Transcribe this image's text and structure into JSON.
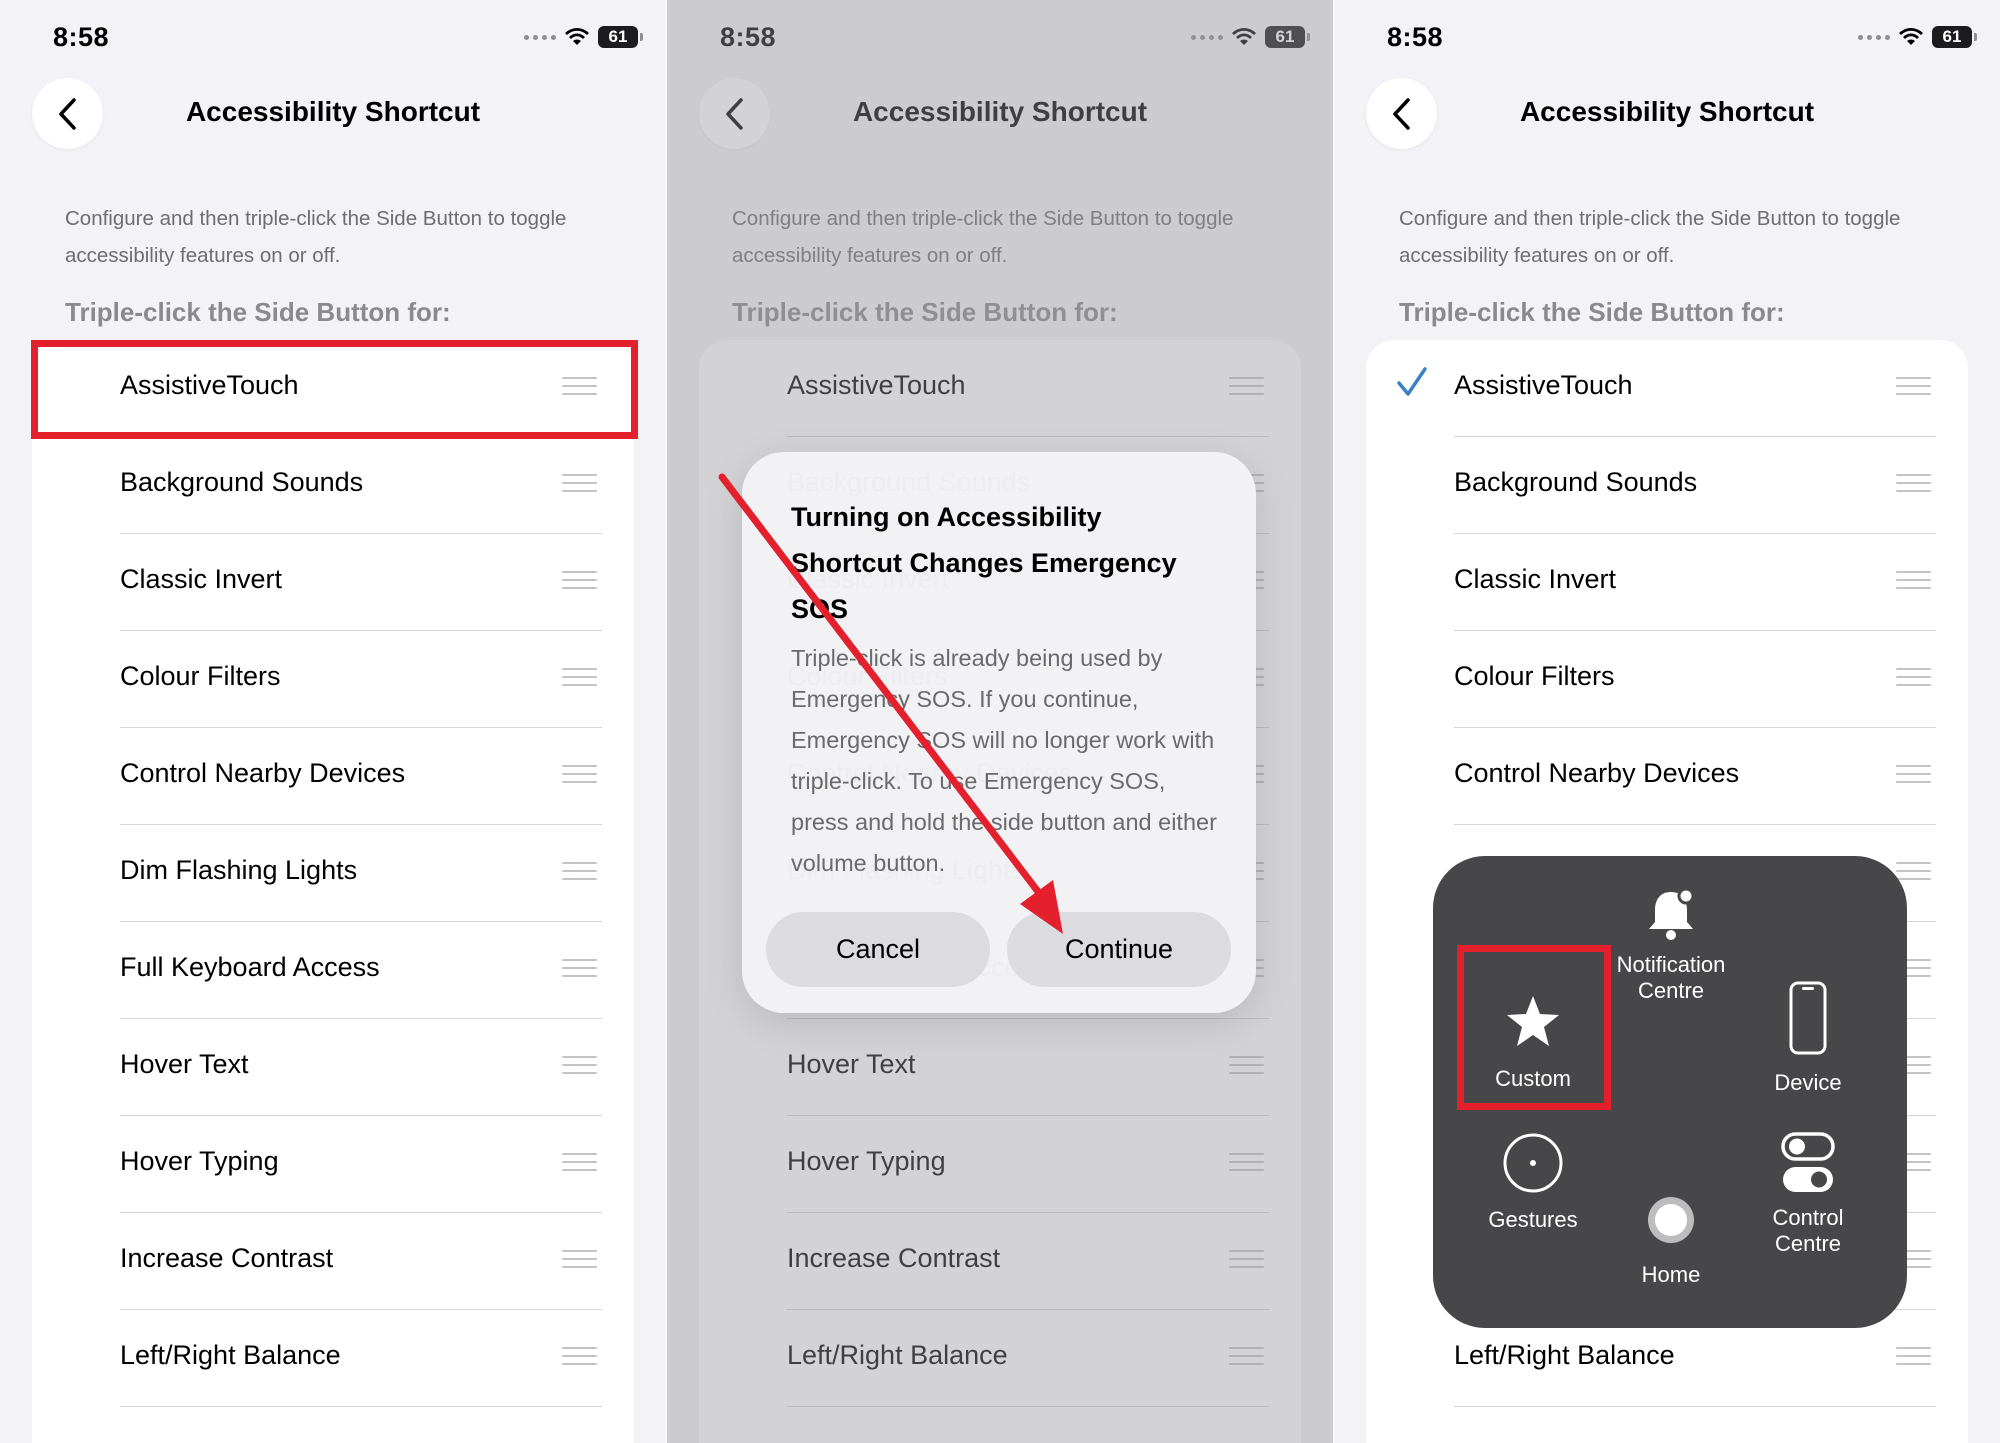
{
  "status": {
    "time": "8:58",
    "battery": "61"
  },
  "header": {
    "title": "Accessibility Shortcut"
  },
  "description": "Configure and then triple-click the Side Button to toggle accessibility features on or off.",
  "section_header": "Triple-click the Side Button for:",
  "items": [
    "AssistiveTouch",
    "Background Sounds",
    "Classic Invert",
    "Colour Filters",
    "Control Nearby Devices",
    "Dim Flashing Lights",
    "Full Keyboard Access",
    "Hover Text",
    "Hover Typing",
    "Increase Contrast",
    "Left/Right Balance"
  ],
  "alert": {
    "title": "Turning on Accessibility Shortcut Changes Emergency SOS",
    "message": "Triple-click is already being used by Emergency SOS. If you continue, Emergency SOS will no longer work with triple-click. To use Emergency SOS, press and hold the side button and either volume button.",
    "cancel": "Cancel",
    "continue": "Continue"
  },
  "assistive_menu": {
    "notification": "Notification Centre",
    "custom": "Custom",
    "device": "Device",
    "gestures": "Gestures",
    "home": "Home",
    "control": "Control Centre"
  },
  "colors": {
    "highlight_red": "#e3202b",
    "check_blue": "#3a82c8",
    "menu_bg": "#474749"
  },
  "icons": [
    "chevron-left-icon",
    "wifi-icon",
    "battery-icon",
    "reorder-icon",
    "checkmark-icon",
    "bell-icon",
    "star-icon",
    "phone-icon",
    "gestures-icon",
    "home-button-icon",
    "toggles-icon"
  ]
}
